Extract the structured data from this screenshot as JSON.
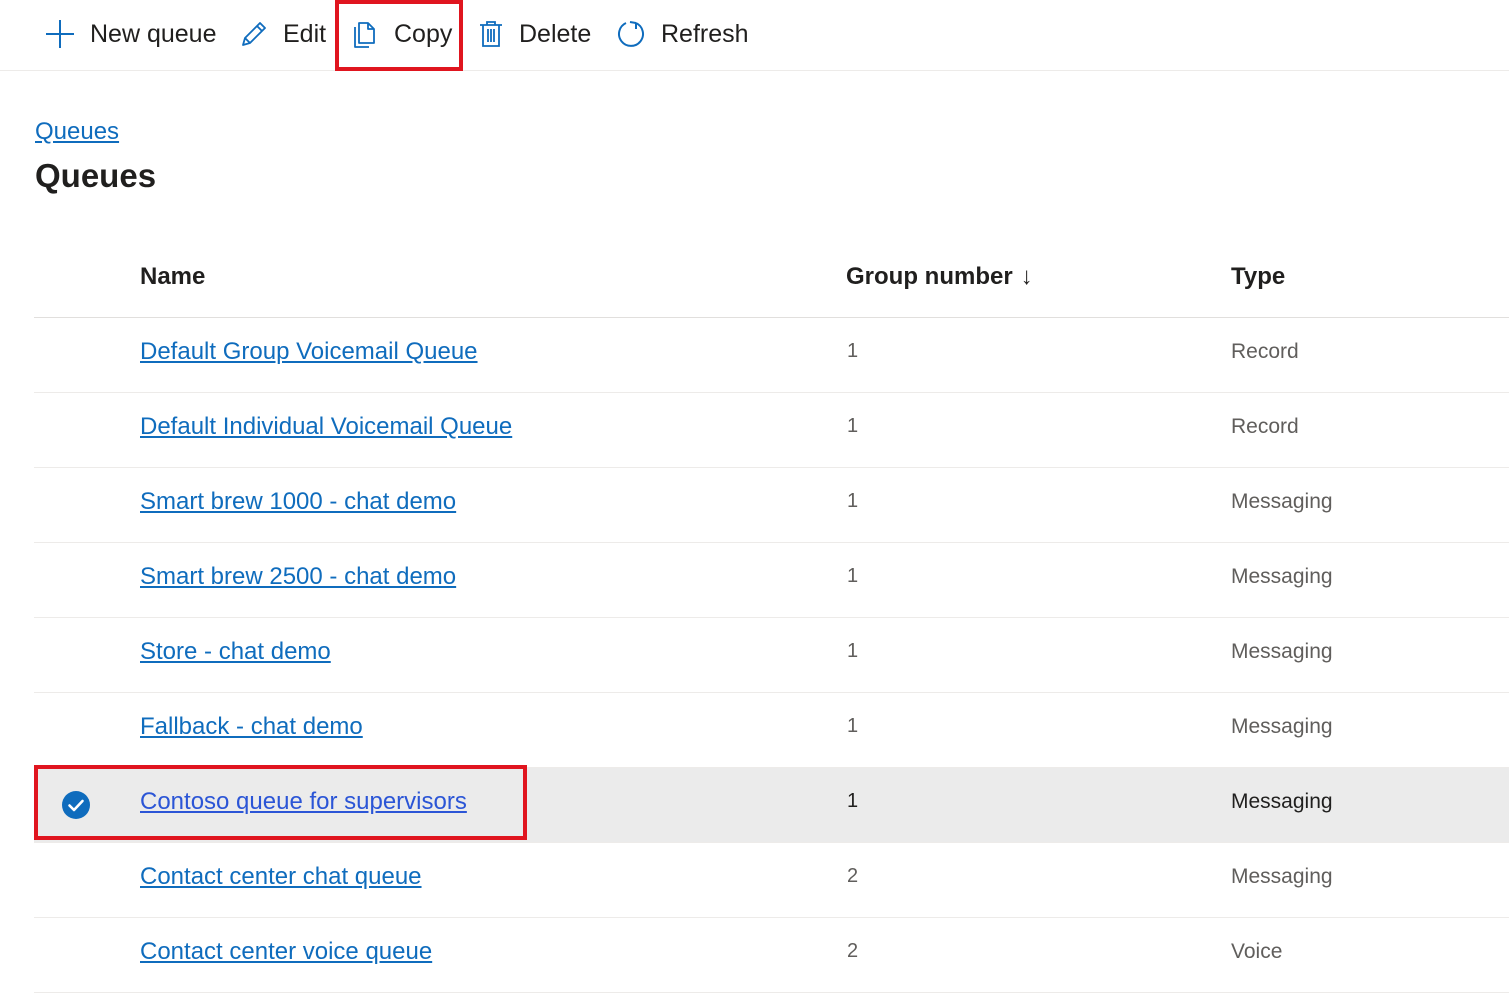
{
  "toolbar": {
    "new_queue": {
      "label": "New queue",
      "icon": "plus-icon"
    },
    "edit": {
      "label": "Edit",
      "icon": "pencil-icon"
    },
    "copy": {
      "label": "Copy",
      "icon": "copy-icon"
    },
    "delete": {
      "label": "Delete",
      "icon": "trash-icon"
    },
    "refresh": {
      "label": "Refresh",
      "icon": "refresh-icon"
    }
  },
  "breadcrumb": {
    "label": "Queues"
  },
  "page": {
    "title": "Queues"
  },
  "table": {
    "columns": {
      "name": "Name",
      "group_number": "Group number",
      "group_number_sort": "↓",
      "type": "Type"
    },
    "rows": [
      {
        "name": "Default Group Voicemail Queue",
        "group_number": "1",
        "type": "Record",
        "selected": false
      },
      {
        "name": "Default Individual Voicemail Queue",
        "group_number": "1",
        "type": "Record",
        "selected": false
      },
      {
        "name": "Smart brew 1000 - chat demo",
        "group_number": "1",
        "type": "Messaging",
        "selected": false
      },
      {
        "name": "Smart brew 2500 - chat demo",
        "group_number": "1",
        "type": "Messaging",
        "selected": false
      },
      {
        "name": "Store - chat demo",
        "group_number": "1",
        "type": "Messaging",
        "selected": false
      },
      {
        "name": "Fallback - chat demo",
        "group_number": "1",
        "type": "Messaging",
        "selected": false
      },
      {
        "name": "Contoso queue for supervisors",
        "group_number": "1",
        "type": "Messaging",
        "selected": true
      },
      {
        "name": "Contact center chat queue",
        "group_number": "2",
        "type": "Messaging",
        "selected": false
      },
      {
        "name": "Contact center voice queue",
        "group_number": "2",
        "type": "Voice",
        "selected": false
      }
    ]
  },
  "colors": {
    "accent": "#0f6cbd",
    "highlight": "#e0151f",
    "selected_row": "#ebebeb"
  }
}
